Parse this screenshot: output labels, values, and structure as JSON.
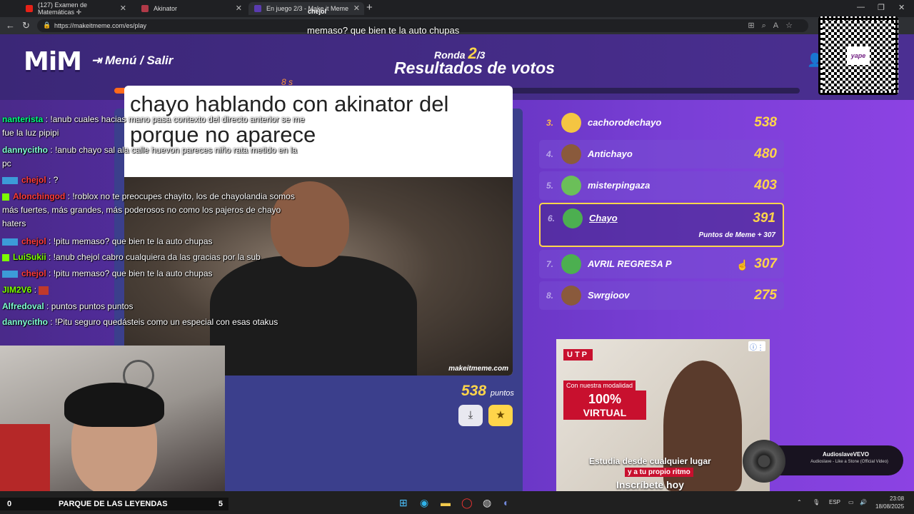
{
  "browser": {
    "tabs": [
      {
        "title": "(127) Examen de Matemáticas ✛",
        "color": "#e62117"
      },
      {
        "title": "Akinator",
        "color": "#b03a48"
      },
      {
        "title": "En juego 2/3 - Make it Meme",
        "color": "#5a3bb0"
      }
    ],
    "url": "https://makeitmeme.com/es/play"
  },
  "stream": {
    "top_text": "memaso? que bien te la auto chupas",
    "user": "chejol"
  },
  "game": {
    "logo": "MiM",
    "menu_label": "Menú / Salir",
    "round_label": "Ronda",
    "round_current": "2",
    "round_total": "/3",
    "title": "Resultados de votos",
    "timer_label": "8 s",
    "timer_fraction": 0.25
  },
  "meme": {
    "caption": "chayo hablando con akinator del porque no aparece",
    "watermark": "makeitmeme.com",
    "points": "538",
    "points_label": "puntos",
    "btn_download": "⤓",
    "btn_star": "★"
  },
  "scoreboard": [
    {
      "rank": "3.",
      "name": "cachorodechayo",
      "score": "538"
    },
    {
      "rank": "4.",
      "name": "Antichayo",
      "score": "480"
    },
    {
      "rank": "5.",
      "name": "misterpingaza",
      "score": "403"
    },
    {
      "rank": "6.",
      "name": "Chayo",
      "score": "391",
      "sub": "Puntos de Meme  + 307"
    },
    {
      "rank": "7.",
      "name": "AVRIL REGRESA P",
      "score": "307"
    },
    {
      "rank": "8.",
      "name": "Swrgioov",
      "score": "275"
    }
  ],
  "ad": {
    "brand": "UTP",
    "line1": "Con nuestra modalidad",
    "line2": "100%",
    "line3": "VIRTUAL",
    "cta1": "Estudia desde cualquier lugar",
    "cta2": "y a tu propio ritmo",
    "cta3": "Inscríbete hoy"
  },
  "chat": [
    {
      "user": "nanterista",
      "color": "#00ff7f",
      "text": " : !anub cuales hacias mano pasa contexto del directo anterior se me fue la luz pipipi"
    },
    {
      "user": "dannycitho",
      "color": "#7fffd4",
      "text": " : !anub chayo sal ala calle huevon pareces niño rata metido en la pc"
    },
    {
      "user": "chejol",
      "color": "#ff3b3b",
      "text": " : ?"
    },
    {
      "user": "Alonchingod",
      "color": "#ff3b3b",
      "text": " : !roblox no te preocupes chayito, los de chayolandia somos más fuertes, más grandes, más poderosos no como los pajeros de chayo haters"
    },
    {
      "user": "chejol",
      "color": "#ff3b3b",
      "text": " : !pitu memaso? que bien te la auto chupas"
    },
    {
      "user": "LuiSukii",
      "color": "#7cfc00",
      "text": " : !anub chejol cabro cualquiera da las gracias por la sub"
    },
    {
      "user": "chejol",
      "color": "#ff3b3b",
      "text": " : !pitu memaso? que bien te la auto chupas"
    },
    {
      "user": "JIM2V6",
      "color": "#7cfc00",
      "text": " : "
    },
    {
      "user": "Alfredoval",
      "color": "#7fffd4",
      "text": " : puntos puntos puntos"
    },
    {
      "user": "dannycitho",
      "color": "#7fffd4",
      "text": " : !Pitu seguro quedásteis como un especial con esas otakus"
    }
  ],
  "scorebar": {
    "left": "0",
    "center": "PARQUE DE LAS LEYENDAS",
    "right": "5"
  },
  "music": {
    "artist": "AudioslaveVEVO",
    "song": "Audioslave - Like a Stone (Official Video)"
  },
  "qr": {
    "label": "yape"
  },
  "taskbar": {
    "lang": "ESP",
    "time": "23:08",
    "date": "18/08/2025"
  }
}
